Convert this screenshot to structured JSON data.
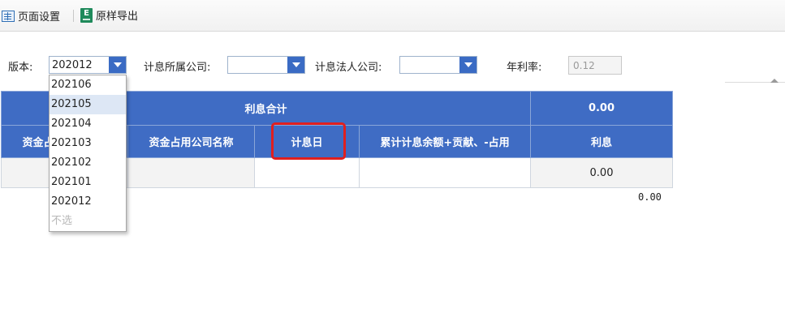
{
  "toolbar": {
    "page_setup_label": "页面设置",
    "export_label": "原样导出",
    "excel_letter": "E"
  },
  "filters": {
    "version_label": "版本:",
    "version_value": "202012",
    "company_label": "计息所属公司:",
    "company_value": "",
    "legal_label": "计息法人公司:",
    "legal_value": "",
    "rate_label": "年利率:",
    "rate_value": "0.12"
  },
  "dropdown": {
    "options": [
      "202106",
      "202105",
      "202104",
      "202103",
      "202102",
      "202101",
      "202012",
      "不选"
    ],
    "hovered": "202105"
  },
  "table": {
    "summary_label": "利息合计",
    "summary_value": "0.00",
    "col_fund_code": "资金占用公司编码",
    "col_fund_name": "资金占用公司名称",
    "col_date": "计息日",
    "col_balance": "累计计息余额+贡献、-占用",
    "col_interest": "利息",
    "row1_interest": "0.00"
  },
  "footer_total": "0.00",
  "colors": {
    "header_blue": "#3f6cc4",
    "highlight_red": "#e01f1f"
  }
}
